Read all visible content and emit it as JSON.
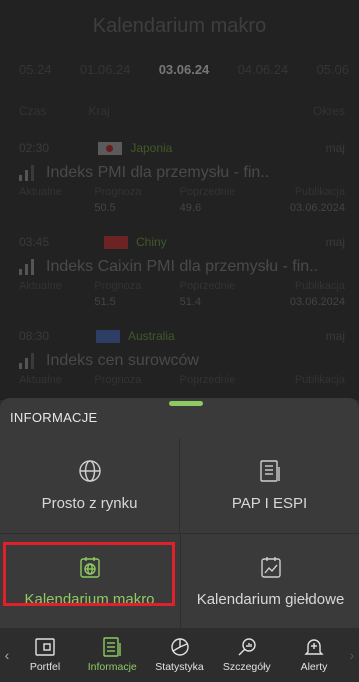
{
  "header": {
    "title": "Kalendarium makro"
  },
  "dates": [
    {
      "label": "05.24",
      "active": false
    },
    {
      "label": "01.06.24",
      "active": false
    },
    {
      "label": "03.06.24",
      "active": true
    },
    {
      "label": "04.06.24",
      "active": false
    },
    {
      "label": "05.06",
      "active": false
    }
  ],
  "columns": {
    "time": "Czas",
    "country": "Kraj",
    "period": "Okres"
  },
  "events": [
    {
      "time": "02:30",
      "country": "Japonia",
      "period": "maj",
      "name": "Indeks PMI dla przemysłu - fin..",
      "labels": [
        "Aktualne",
        "Prognoza",
        "Poprzednie",
        "Publikacja"
      ],
      "values": [
        "",
        "50.5",
        "49.6",
        "03.06.2024"
      ]
    },
    {
      "time": "03:45",
      "country": "Chiny",
      "period": "maj",
      "name": "Indeks Caixin PMI dla przemysłu - fin..",
      "labels": [
        "Aktualne",
        "Prognoza",
        "Poprzednie",
        "Publikacja"
      ],
      "values": [
        "",
        "51.5",
        "51.4",
        "03.06.2024"
      ]
    },
    {
      "time": "08:30",
      "country": "Australia",
      "period": "maj",
      "name": "Indeks cen surowców",
      "labels": [
        "Aktualne",
        "Prognoza",
        "Poprzednie",
        "Publikacja"
      ],
      "values": [
        "",
        "",
        "",
        ""
      ]
    }
  ],
  "sheet": {
    "title": "INFORMACJE",
    "items": [
      {
        "label": "Prosto z rynku",
        "icon": "globe-icon"
      },
      {
        "label": "PAP I ESPI",
        "icon": "document-icon"
      },
      {
        "label": "Kalendarium makro",
        "icon": "calendar-globe-icon",
        "active": true
      },
      {
        "label": "Kalendarium giełdowe",
        "icon": "calendar-chart-icon"
      }
    ]
  },
  "nav": {
    "items": [
      {
        "label": "Portfel",
        "icon": "wallet-icon"
      },
      {
        "label": "Informacje",
        "icon": "news-icon",
        "active": true
      },
      {
        "label": "Statystyka",
        "icon": "stats-icon"
      },
      {
        "label": "Szczegóły",
        "icon": "details-search-icon"
      },
      {
        "label": "Alerty",
        "icon": "bell-add-icon"
      }
    ]
  },
  "colors": {
    "accent": "#8fca62",
    "highlight": "#e0202a",
    "sheet_bg": "#3a3a3a"
  }
}
